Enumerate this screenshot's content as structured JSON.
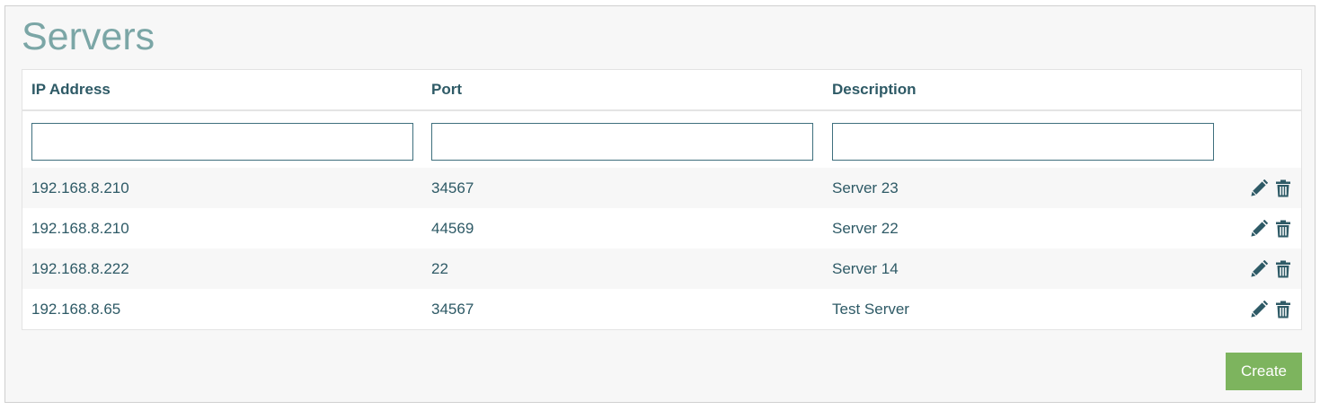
{
  "page": {
    "title": "Servers"
  },
  "table": {
    "columns": {
      "ip": "IP Address",
      "port": "Port",
      "description": "Description"
    },
    "filters": {
      "ip": "",
      "port": "",
      "description": ""
    },
    "rows": [
      {
        "ip": "192.168.8.210",
        "port": "34567",
        "description": "Server 23"
      },
      {
        "ip": "192.168.8.210",
        "port": "44569",
        "description": "Server 22"
      },
      {
        "ip": "192.168.8.222",
        "port": "22",
        "description": "Server 14"
      },
      {
        "ip": "192.168.8.65",
        "port": "34567",
        "description": "Test Server"
      }
    ],
    "row_actions": {
      "edit_icon": "pencil-icon",
      "delete_icon": "trash-icon"
    }
  },
  "footer": {
    "create_label": "Create"
  },
  "colors": {
    "title": "#7ba6a6",
    "text": "#2e5a66",
    "create_button": "#7db45e",
    "input_border": "#3e6f7d"
  }
}
